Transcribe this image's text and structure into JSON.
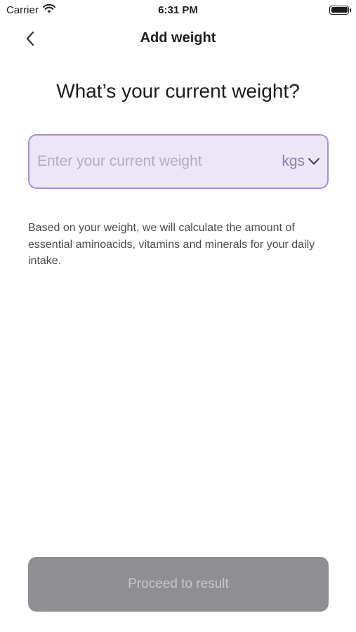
{
  "status_bar": {
    "carrier": "Carrier",
    "time": "6:31 PM"
  },
  "nav": {
    "title": "Add weight"
  },
  "question": "What’s your current weight?",
  "weight_input": {
    "value": "",
    "placeholder": "Enter your current weight"
  },
  "unit_select": {
    "selected": "kgs"
  },
  "description": "Based on your weight, we will calculate the amount of essential aminoacids, vitamins and minerals for your daily intake.",
  "proceed_button": {
    "label": "Proceed to result",
    "state": "disabled"
  },
  "colors": {
    "field_background": "#ece7f8",
    "field_border": "#a48fd4",
    "button_disabled": "#8e8e93"
  }
}
